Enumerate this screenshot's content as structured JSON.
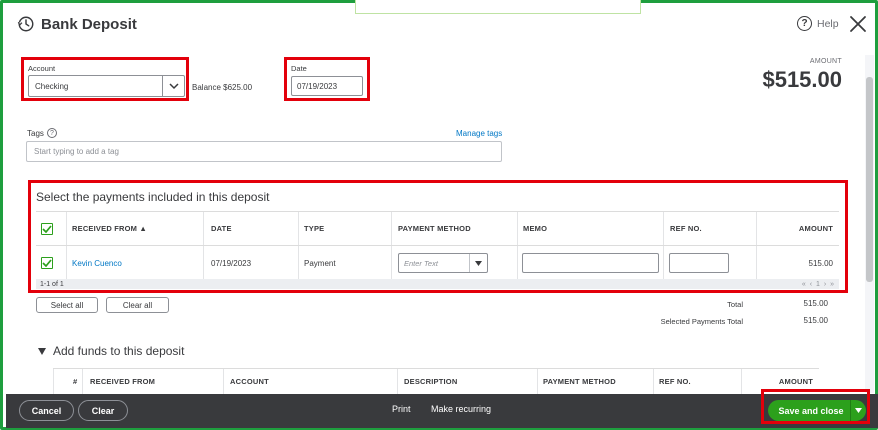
{
  "header": {
    "title": "Bank Deposit",
    "help_label": "Help"
  },
  "account": {
    "label": "Account",
    "value": "Checking",
    "balance": "Balance $625.00"
  },
  "date": {
    "label": "Date",
    "value": "07/19/2023"
  },
  "amount": {
    "label": "AMOUNT",
    "value": "$515.00"
  },
  "tags": {
    "label": "Tags",
    "manage_label": "Manage tags",
    "placeholder": "Start typing to add a tag"
  },
  "payments": {
    "title": "Select the payments included in this deposit",
    "columns": {
      "received_from": "RECEIVED FROM ▲",
      "date": "DATE",
      "type": "TYPE",
      "payment_method": "PAYMENT METHOD",
      "memo": "MEMO",
      "ref_no": "REF NO.",
      "amount": "AMOUNT"
    },
    "rows": [
      {
        "received_from": "Kevin Cuenco",
        "date": "07/19/2023",
        "type": "Payment",
        "payment_method_placeholder": "Enter Text",
        "amount": "515.00"
      }
    ],
    "pager_text": "1-1 of 1",
    "pager_nav": "« ‹ 1 › »",
    "select_all": "Select all",
    "clear_all": "Clear all",
    "total_label": "Total",
    "total_value": "515.00",
    "selected_label": "Selected Payments Total",
    "selected_value": "515.00"
  },
  "funds": {
    "title": "Add funds to this deposit",
    "columns": {
      "num": "#",
      "received_from": "RECEIVED FROM",
      "account": "ACCOUNT",
      "description": "DESCRIPTION",
      "payment_method": "PAYMENT METHOD",
      "ref_no": "REF NO.",
      "amount": "AMOUNT"
    }
  },
  "footer": {
    "cancel": "Cancel",
    "clear": "Clear",
    "print": "Print",
    "make_recurring": "Make recurring",
    "save_and_close": "Save and close"
  },
  "colors": {
    "accent_green": "#2ca01c",
    "frame_green": "#1e9e3e",
    "highlight_red": "#e3000b",
    "link_blue": "#0077c5",
    "footer_dark": "#393a3d"
  }
}
